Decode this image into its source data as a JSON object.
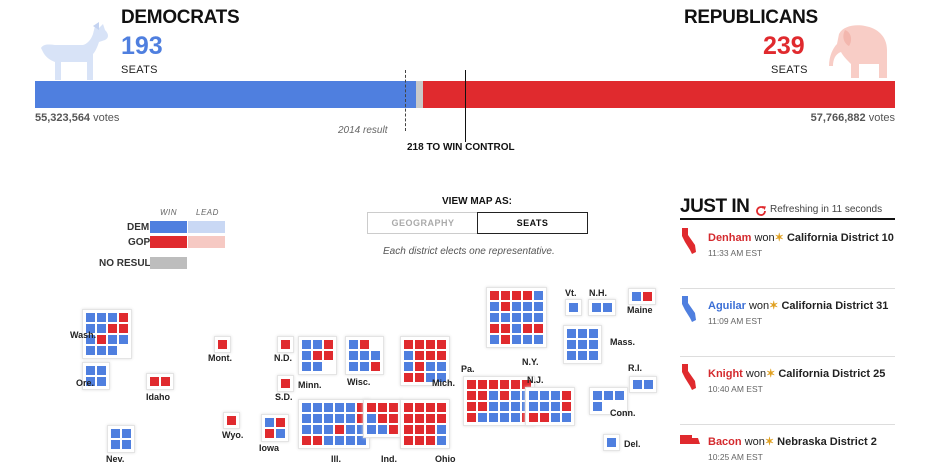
{
  "dem": {
    "name": "DEMOCRATS",
    "seats": "193",
    "seats_label": "SEATS",
    "votes": "55,323,564",
    "votes_label": "votes"
  },
  "rep": {
    "name": "REPUBLICANS",
    "seats": "239",
    "seats_label": "SEATS",
    "votes": "57,766,882",
    "votes_label": "votes"
  },
  "colors": {
    "dem": "#4f7fdf",
    "rep": "#e02a2e",
    "dem_lead": "#c9d8f4",
    "rep_lead": "#f6c9c3",
    "no_result": "#bdbdbd"
  },
  "bar": {
    "total_seats": 435,
    "dem_seats": 193,
    "rep_seats": 239
  },
  "markers": {
    "result_2014": "2014 result",
    "win_control": "218 TO WIN CONTROL"
  },
  "legend": {
    "win": "WIN",
    "lead": "LEAD",
    "dem": "DEM",
    "gop": "GOP",
    "no_result": "NO RESULT"
  },
  "view_map": {
    "title": "VIEW MAP AS:",
    "options": [
      "GEOGRAPHY",
      "SEATS"
    ],
    "selected": "SEATS",
    "note": "Each district elects one representative."
  },
  "states": {
    "wash": "Wash.",
    "ore": "Ore.",
    "idaho": "Idaho",
    "nev": "Nev.",
    "mont": "Mont.",
    "wyo": "Wyo.",
    "nd": "N.D.",
    "sd": "S.D.",
    "iowa": "Iowa",
    "minn": "Minn.",
    "wisc": "Wisc.",
    "ill": "Ill.",
    "ind": "Ind.",
    "mich": "Mich.",
    "ohio": "Ohio",
    "pa": "Pa.",
    "ny": "N.Y.",
    "nj": "N.J.",
    "vt": "Vt.",
    "nh": "N.H.",
    "maine": "Maine",
    "mass": "Mass.",
    "ri": "R.I.",
    "conn": "Conn.",
    "del": "Del."
  },
  "just_in": {
    "title": "JUST IN",
    "refresh": "Refreshing in 11 seconds",
    "won_word": "won",
    "items": [
      {
        "name": "Denham",
        "party": "R",
        "district": "California District 10",
        "time": "11:33 AM EST",
        "state_icon": "california-icon"
      },
      {
        "name": "Aguilar",
        "party": "D",
        "district": "California District 31",
        "time": "11:09 AM EST",
        "state_icon": "california-icon"
      },
      {
        "name": "Knight",
        "party": "R",
        "district": "California District 25",
        "time": "10:40 AM EST",
        "state_icon": "california-icon"
      },
      {
        "name": "Bacon",
        "party": "R",
        "district": "Nebraska District 2",
        "time": "10:25 AM EST",
        "state_icon": "nebraska-icon"
      }
    ]
  }
}
